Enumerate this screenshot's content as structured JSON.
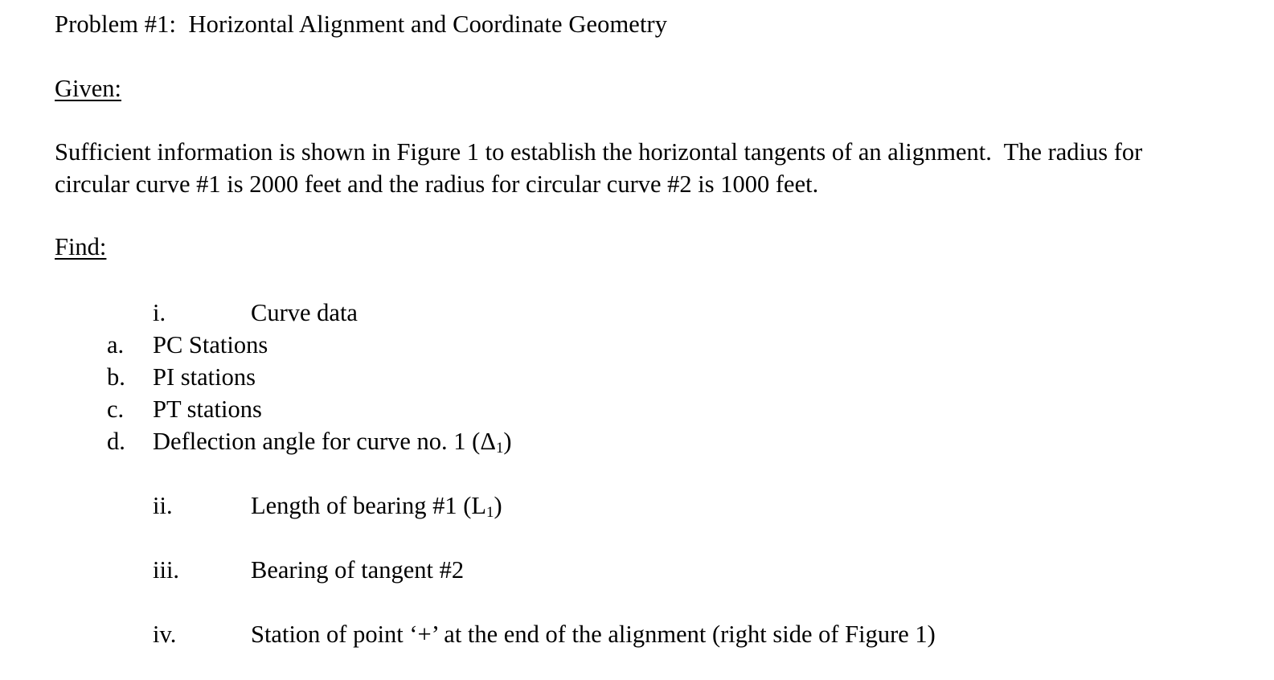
{
  "document": {
    "title": "Problem #1:  Horizontal Alignment and Coordinate Geometry",
    "given_heading": "Given:",
    "given_text": "Sufficient information is shown in Figure 1 to establish the horizontal tangents of an alignment.  The radius for circular curve #1 is 2000 feet and the radius for circular curve #2 is 1000 feet.",
    "find_heading": "Find:",
    "items": [
      {
        "marker": "i.",
        "text": "Curve data",
        "level": "roman"
      },
      {
        "marker": "a.",
        "text": "PC Stations",
        "level": "letter"
      },
      {
        "marker": "b.",
        "text": "PI stations",
        "level": "letter"
      },
      {
        "marker": "c.",
        "text": "PT stations",
        "level": "letter"
      },
      {
        "marker": "d.",
        "text_prefix": "Deflection angle for curve no. 1 (Δ",
        "text_sub": "1",
        "text_suffix": ")",
        "level": "letter"
      },
      {
        "marker": "ii.",
        "text_prefix": "Length of bearing #1 (L",
        "text_sub": "1",
        "text_suffix": ")",
        "level": "roman"
      },
      {
        "marker": "iii.",
        "text": "Bearing of tangent #2",
        "level": "roman"
      },
      {
        "marker": "iv.",
        "text": "Station of point ‘+’ at the end of the alignment (right side of Figure 1)",
        "level": "roman"
      }
    ]
  },
  "colors": {
    "background": "#ffffff",
    "text": "#000000"
  }
}
